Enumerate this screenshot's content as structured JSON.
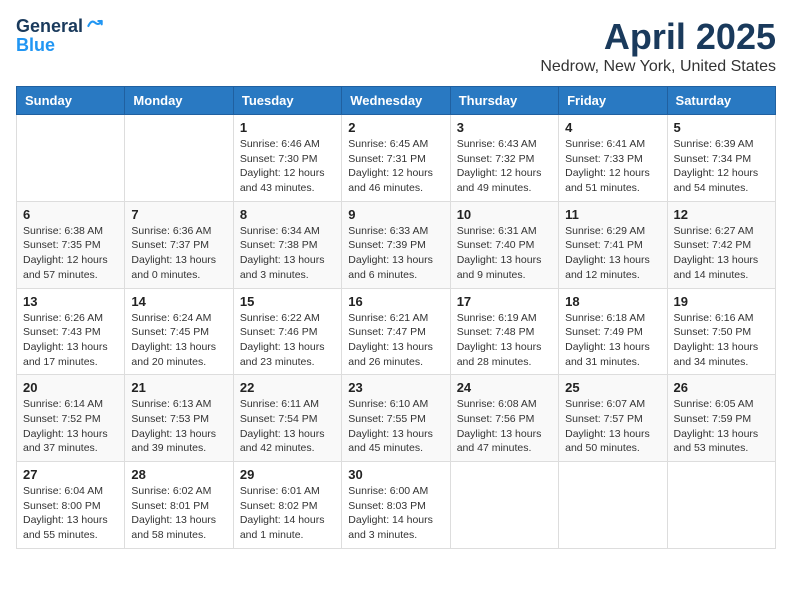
{
  "logo": {
    "general": "General",
    "blue": "Blue"
  },
  "header": {
    "month": "April 2025",
    "location": "Nedrow, New York, United States"
  },
  "weekdays": [
    "Sunday",
    "Monday",
    "Tuesday",
    "Wednesday",
    "Thursday",
    "Friday",
    "Saturday"
  ],
  "weeks": [
    [
      {
        "day": "",
        "info": ""
      },
      {
        "day": "",
        "info": ""
      },
      {
        "day": "1",
        "info": "Sunrise: 6:46 AM\nSunset: 7:30 PM\nDaylight: 12 hours and 43 minutes."
      },
      {
        "day": "2",
        "info": "Sunrise: 6:45 AM\nSunset: 7:31 PM\nDaylight: 12 hours and 46 minutes."
      },
      {
        "day": "3",
        "info": "Sunrise: 6:43 AM\nSunset: 7:32 PM\nDaylight: 12 hours and 49 minutes."
      },
      {
        "day": "4",
        "info": "Sunrise: 6:41 AM\nSunset: 7:33 PM\nDaylight: 12 hours and 51 minutes."
      },
      {
        "day": "5",
        "info": "Sunrise: 6:39 AM\nSunset: 7:34 PM\nDaylight: 12 hours and 54 minutes."
      }
    ],
    [
      {
        "day": "6",
        "info": "Sunrise: 6:38 AM\nSunset: 7:35 PM\nDaylight: 12 hours and 57 minutes."
      },
      {
        "day": "7",
        "info": "Sunrise: 6:36 AM\nSunset: 7:37 PM\nDaylight: 13 hours and 0 minutes."
      },
      {
        "day": "8",
        "info": "Sunrise: 6:34 AM\nSunset: 7:38 PM\nDaylight: 13 hours and 3 minutes."
      },
      {
        "day": "9",
        "info": "Sunrise: 6:33 AM\nSunset: 7:39 PM\nDaylight: 13 hours and 6 minutes."
      },
      {
        "day": "10",
        "info": "Sunrise: 6:31 AM\nSunset: 7:40 PM\nDaylight: 13 hours and 9 minutes."
      },
      {
        "day": "11",
        "info": "Sunrise: 6:29 AM\nSunset: 7:41 PM\nDaylight: 13 hours and 12 minutes."
      },
      {
        "day": "12",
        "info": "Sunrise: 6:27 AM\nSunset: 7:42 PM\nDaylight: 13 hours and 14 minutes."
      }
    ],
    [
      {
        "day": "13",
        "info": "Sunrise: 6:26 AM\nSunset: 7:43 PM\nDaylight: 13 hours and 17 minutes."
      },
      {
        "day": "14",
        "info": "Sunrise: 6:24 AM\nSunset: 7:45 PM\nDaylight: 13 hours and 20 minutes."
      },
      {
        "day": "15",
        "info": "Sunrise: 6:22 AM\nSunset: 7:46 PM\nDaylight: 13 hours and 23 minutes."
      },
      {
        "day": "16",
        "info": "Sunrise: 6:21 AM\nSunset: 7:47 PM\nDaylight: 13 hours and 26 minutes."
      },
      {
        "day": "17",
        "info": "Sunrise: 6:19 AM\nSunset: 7:48 PM\nDaylight: 13 hours and 28 minutes."
      },
      {
        "day": "18",
        "info": "Sunrise: 6:18 AM\nSunset: 7:49 PM\nDaylight: 13 hours and 31 minutes."
      },
      {
        "day": "19",
        "info": "Sunrise: 6:16 AM\nSunset: 7:50 PM\nDaylight: 13 hours and 34 minutes."
      }
    ],
    [
      {
        "day": "20",
        "info": "Sunrise: 6:14 AM\nSunset: 7:52 PM\nDaylight: 13 hours and 37 minutes."
      },
      {
        "day": "21",
        "info": "Sunrise: 6:13 AM\nSunset: 7:53 PM\nDaylight: 13 hours and 39 minutes."
      },
      {
        "day": "22",
        "info": "Sunrise: 6:11 AM\nSunset: 7:54 PM\nDaylight: 13 hours and 42 minutes."
      },
      {
        "day": "23",
        "info": "Sunrise: 6:10 AM\nSunset: 7:55 PM\nDaylight: 13 hours and 45 minutes."
      },
      {
        "day": "24",
        "info": "Sunrise: 6:08 AM\nSunset: 7:56 PM\nDaylight: 13 hours and 47 minutes."
      },
      {
        "day": "25",
        "info": "Sunrise: 6:07 AM\nSunset: 7:57 PM\nDaylight: 13 hours and 50 minutes."
      },
      {
        "day": "26",
        "info": "Sunrise: 6:05 AM\nSunset: 7:59 PM\nDaylight: 13 hours and 53 minutes."
      }
    ],
    [
      {
        "day": "27",
        "info": "Sunrise: 6:04 AM\nSunset: 8:00 PM\nDaylight: 13 hours and 55 minutes."
      },
      {
        "day": "28",
        "info": "Sunrise: 6:02 AM\nSunset: 8:01 PM\nDaylight: 13 hours and 58 minutes."
      },
      {
        "day": "29",
        "info": "Sunrise: 6:01 AM\nSunset: 8:02 PM\nDaylight: 14 hours and 1 minute."
      },
      {
        "day": "30",
        "info": "Sunrise: 6:00 AM\nSunset: 8:03 PM\nDaylight: 14 hours and 3 minutes."
      },
      {
        "day": "",
        "info": ""
      },
      {
        "day": "",
        "info": ""
      },
      {
        "day": "",
        "info": ""
      }
    ]
  ]
}
